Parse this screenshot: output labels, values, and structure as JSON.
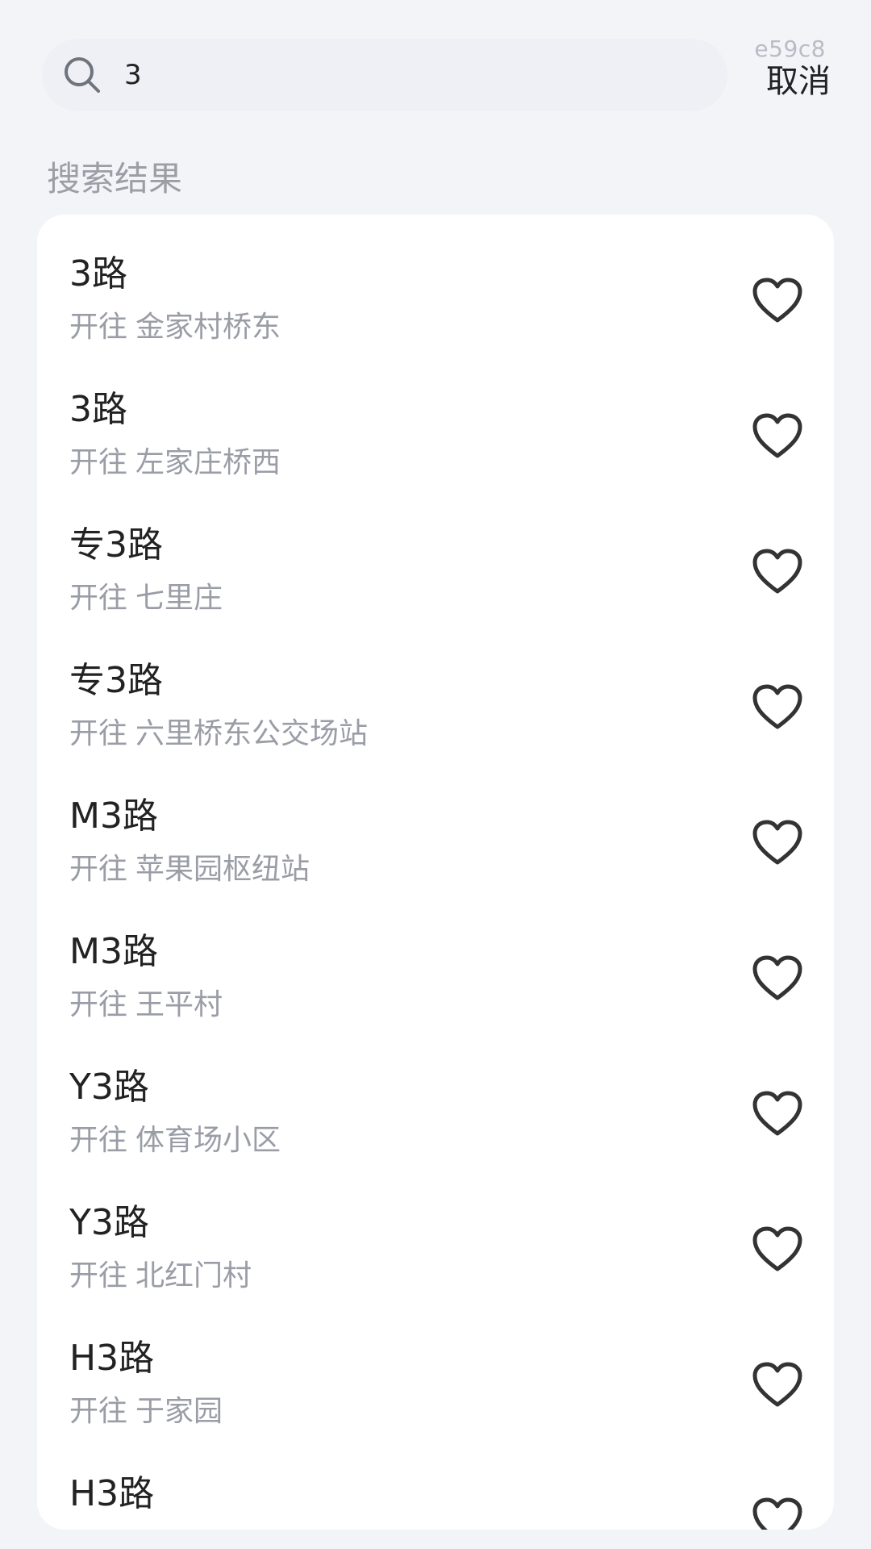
{
  "search": {
    "value": "3",
    "icon": "search-icon",
    "cancel_label": "取消",
    "debug_tag": "e59c8"
  },
  "section": {
    "title": "搜索结果"
  },
  "results": [
    {
      "route": "3路",
      "dest_prefix": "开往",
      "destination": "金家村桥东"
    },
    {
      "route": "3路",
      "dest_prefix": "开往",
      "destination": "左家庄桥西"
    },
    {
      "route": "专3路",
      "dest_prefix": "开往",
      "destination": "七里庄"
    },
    {
      "route": "专3路",
      "dest_prefix": "开往",
      "destination": "六里桥东公交场站"
    },
    {
      "route": "M3路",
      "dest_prefix": "开往",
      "destination": "苹果园枢纽站"
    },
    {
      "route": "M3路",
      "dest_prefix": "开往",
      "destination": "王平村"
    },
    {
      "route": "Y3路",
      "dest_prefix": "开往",
      "destination": "体育场小区"
    },
    {
      "route": "Y3路",
      "dest_prefix": "开往",
      "destination": "北红门村"
    },
    {
      "route": "H3路",
      "dest_prefix": "开往",
      "destination": "于家园"
    },
    {
      "route": "H3路",
      "dest_prefix": "",
      "destination": ""
    }
  ],
  "icons": {
    "favorite": "heart-icon"
  },
  "colors": {
    "background": "#f3f4f8",
    "card": "#ffffff",
    "primary_text": "#222222",
    "secondary_text": "#9a9da6"
  }
}
